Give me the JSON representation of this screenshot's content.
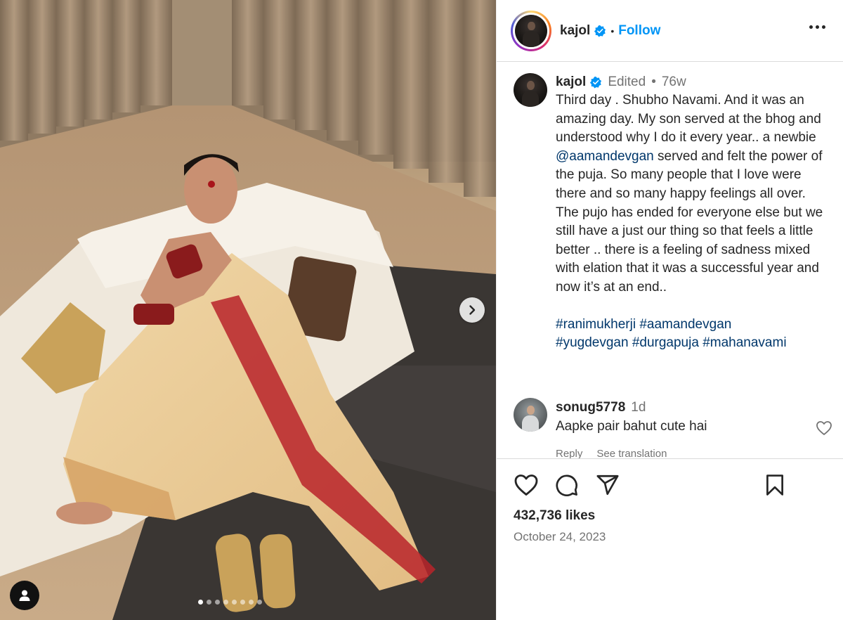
{
  "post": {
    "author": "kajol",
    "follow_label": "Follow",
    "header_separator": "•"
  },
  "caption": {
    "username": "kajol",
    "edited": "Edited",
    "dot": "•",
    "age": "76w",
    "text_before_mention": "Third day . Shubho Navami. And it was an amazing day. My son served at the bhog and understood why I do it every year.. a newbie ",
    "mention": "@aamandevgan",
    "text_after_mention": " served and felt the power of the puja. So many people that I love were there and so many happy feelings all over. The pujo has ended for everyone else but we still have a just our thing so that feels a little better .. there is a feeling of sadness mixed with elation that it was a successful year and now it’s at an end..",
    "hashtags": [
      "#ranimukherji",
      "#aamandevgan",
      "#yugdevgan",
      "#durgapuja",
      "#mahanavami"
    ]
  },
  "comment": {
    "username": "sonug5778",
    "age": "1d",
    "text": "Aapke pair bahut cute hai",
    "reply_label": "Reply",
    "translation_label": "See translation"
  },
  "engagement": {
    "likes": "432,736 likes",
    "date": "October 24, 2023"
  },
  "carousel": {
    "total_slides": 8,
    "active_index": 0
  },
  "colors": {
    "link_blue": "#0095f6",
    "mention_blue": "#00376b",
    "muted_gray": "#737373",
    "verified_blue": "#0095f6"
  },
  "icons": [
    "verified-badge-icon",
    "more-options-icon",
    "chevron-right-icon",
    "user-tag-icon",
    "heart-icon",
    "comment-icon",
    "share-icon",
    "bookmark-icon"
  ]
}
